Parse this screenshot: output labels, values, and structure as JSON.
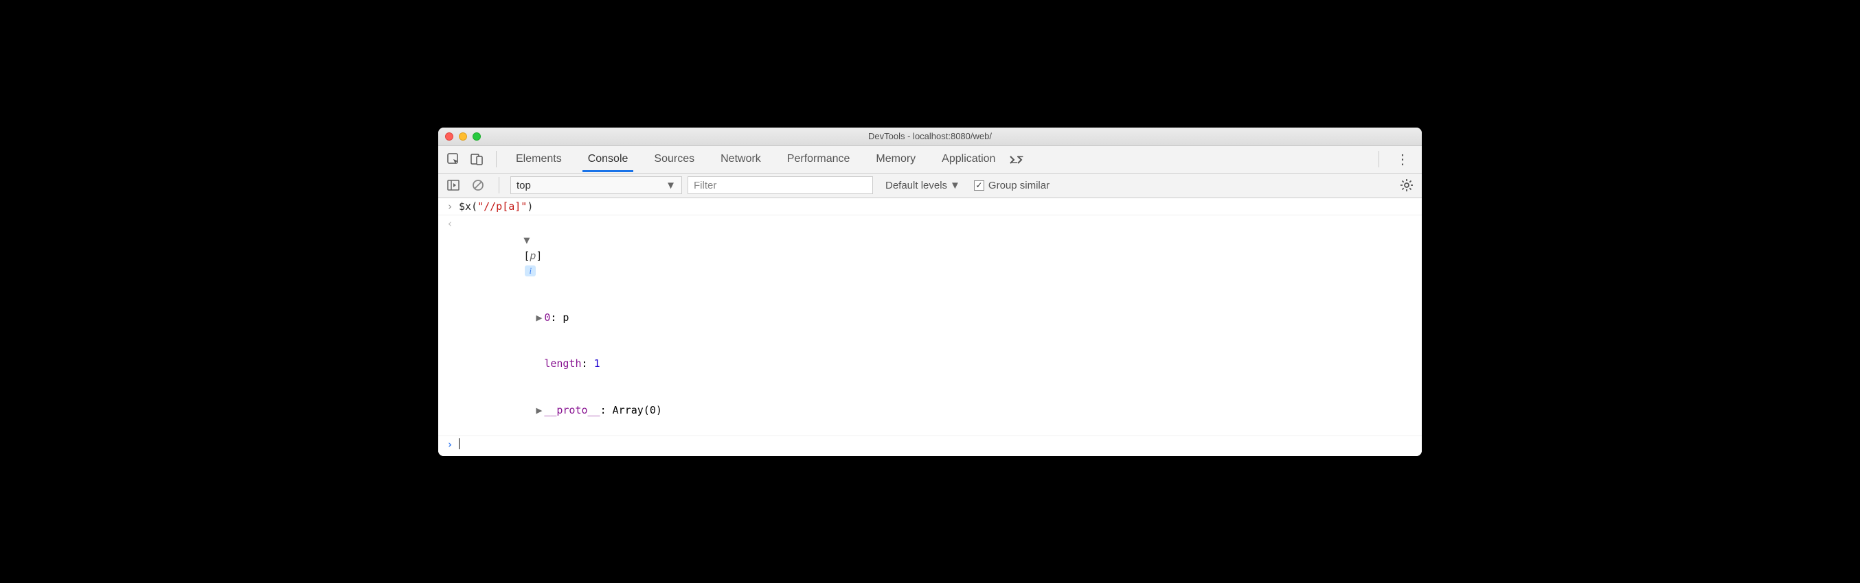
{
  "window": {
    "title": "DevTools - localhost:8080/web/"
  },
  "tabs": {
    "items": [
      "Elements",
      "Console",
      "Sources",
      "Network",
      "Performance",
      "Memory",
      "Application"
    ],
    "active_index": 1
  },
  "subbar": {
    "context": "top",
    "filter_placeholder": "Filter",
    "levels_label": "Default levels",
    "group_similar_checked": true,
    "group_similar_label": "Group similar"
  },
  "console": {
    "input": "$x(\"//p[a]\")",
    "result": {
      "summary_open": "[",
      "summary_item": "p",
      "summary_close": "]",
      "line_index_key": "0",
      "line_index_val": "p",
      "length_key": "length",
      "length_val": "1",
      "proto_key": "__proto__",
      "proto_val": "Array(0)"
    }
  }
}
